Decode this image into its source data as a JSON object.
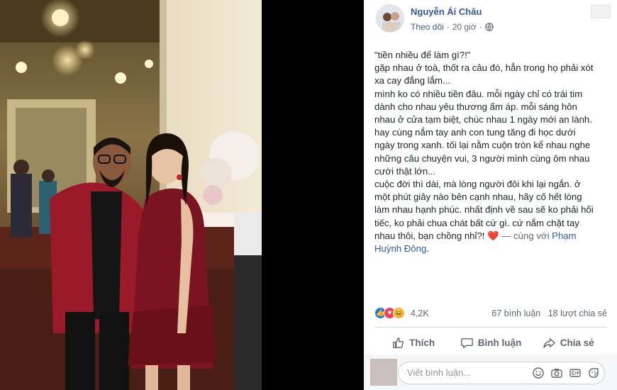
{
  "post": {
    "author": "Nguyễn Ái Châu",
    "follow_label": "Theo dõi",
    "separator": "·",
    "time": "20 giờ",
    "body_lines": [
      "\"tiền nhiều để làm gì?!\"",
      "gặp nhau ở toà, thốt ra câu đó, hẳn trong họ phải xót",
      "xa cay đắng lắm...",
      "mình ko có nhiều tiền đâu. mỗi ngày chỉ có trái tim",
      "dành cho nhau yêu thương ấm áp. mỗi sáng hôn",
      "nhau ở cửa tạm biệt, chúc nhau 1 ngày mới an lành.",
      "hay cùng nắm tay anh con tung tăng đi học dưới",
      "ngày trong xanh. tối lại nằm cuộn tròn kể nhau nghe",
      "những câu chuyện vui, 3 người mình cùng ôm nhau",
      "cười thật lớn...",
      "cuộc đời thì dài, mà lòng người đôi khi lại ngắn. ở",
      "một phút giây nào bên cạnh nhau, hãy cố hết lòng",
      "làm nhau hạnh phúc. nhất định về sau sẽ ko phải hối",
      "tiếc, ko phải chua chát bất cứ gì. cứ nắm chặt tay"
    ],
    "last_line_text": "nhau thôi, bạn chồng nhỉ?! ",
    "heart": "❤️",
    "with_text": " — cùng với ",
    "tag_part1": "Phạm",
    "tag_part2": "Huỳnh Đông",
    "tag_end": "."
  },
  "reactions": {
    "icons": [
      "like-icon",
      "love-icon",
      "haha-icon"
    ],
    "count": "4,2K",
    "comments": "67 bình luận",
    "shares": "18 lượt chia sẻ"
  },
  "actions": {
    "like": "Thích",
    "comment": "Bình luận",
    "share": "Chia sẻ"
  },
  "comment_input": {
    "placeholder": "Viết bình luận..."
  },
  "colors": {
    "link": "#365899",
    "text": "#1d2129",
    "muted": "#606770",
    "like": "#1877f2",
    "love": "#f33e58",
    "haha": "#f7b125"
  }
}
